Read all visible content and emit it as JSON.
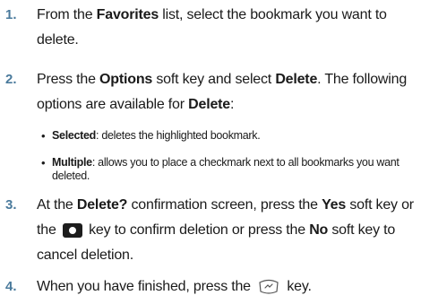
{
  "steps": [
    {
      "number": "1.",
      "parts": {
        "a": "From the ",
        "b": "Favorites",
        "c": " list, select the bookmark you want to delete."
      }
    },
    {
      "number": "2.",
      "parts": {
        "a": "Press the ",
        "b": "Options",
        "c": " soft key and select ",
        "d": "Delete",
        "e": ". The following options are available for ",
        "f": "Delete",
        "g": ":"
      },
      "options": [
        {
          "bullet": "•",
          "term": "Selected",
          "desc": ": deletes the highlighted bookmark."
        },
        {
          "bullet": "•",
          "term": "Multiple",
          "desc": ": allows you to place a checkmark next to all bookmarks you want deleted."
        }
      ]
    },
    {
      "number": "3.",
      "parts": {
        "a": "At the ",
        "b": "Delete?",
        "c": " confirmation screen, press the ",
        "d": "Yes",
        "e": " soft key or the ",
        "f": " key to confirm deletion or press the ",
        "g": "No",
        "h": " soft key to cancel deletion."
      },
      "key_icon": "ok-key-icon"
    },
    {
      "number": "4.",
      "parts": {
        "a": "When you have finished, press the ",
        "b": " key."
      },
      "key_icon": "end-key-icon"
    }
  ],
  "colors": {
    "step_number": "#4a7a9c",
    "text": "#1a1a1a"
  }
}
